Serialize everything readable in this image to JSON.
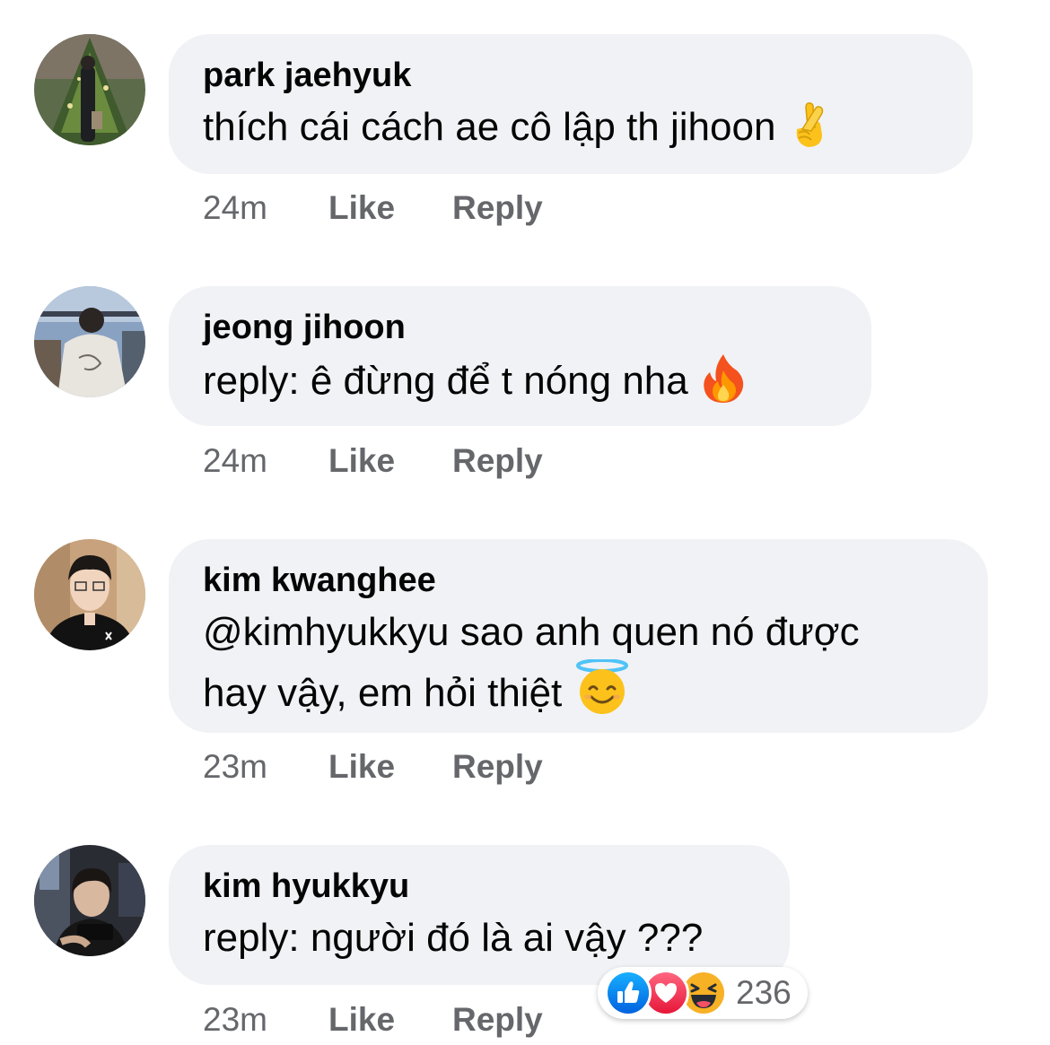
{
  "comments": [
    {
      "author": "park jaehyuk",
      "text": "thích cái cách ae cô lập th jihoon",
      "emoji": "crossed-fingers",
      "time": "24m",
      "like_label": "Like",
      "reply_label": "Reply"
    },
    {
      "author": "jeong jihoon",
      "text": "reply: ê đừng để t nóng nha",
      "emoji": "fire",
      "time": "24m",
      "like_label": "Like",
      "reply_label": "Reply"
    },
    {
      "author": "kim kwanghee",
      "text_line1": "@kimhyukkyu sao anh quen nó được",
      "text_line2": "hay vậy, em hỏi thiệt",
      "emoji": "smiling-face-with-halo",
      "time": "23m",
      "like_label": "Like",
      "reply_label": "Reply"
    },
    {
      "author": "kim hyukkyu",
      "text": "reply: người đó là ai vậy ???",
      "time": "23m",
      "like_label": "Like",
      "reply_label": "Reply"
    }
  ],
  "reactions": {
    "icons": [
      "like-icon",
      "love-icon",
      "haha-icon"
    ],
    "count": "236"
  },
  "colors": {
    "bubble": "#f0f2f5",
    "meta_text": "#65676b",
    "like_blue": "#1877f2",
    "love_red": "#f33e58",
    "haha_yellow": "#f7b125"
  }
}
